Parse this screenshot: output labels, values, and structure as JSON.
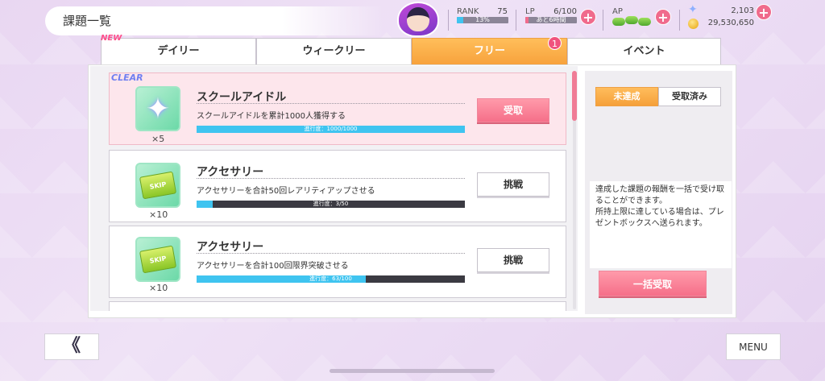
{
  "header": {
    "title": "課題一覧",
    "rank_label": "RANK",
    "rank_value": "75",
    "rank_progress_text": "13%",
    "rank_progress": 0.13,
    "lp_label": "LP",
    "lp_value": "6/100",
    "lp_timer": "あと6時間",
    "lp_progress": 0.06,
    "ap_label": "AP",
    "gems": "2,103",
    "coins": "29,530,650",
    "plus": "+"
  },
  "tabs": [
    {
      "label": "デイリー",
      "tag": "NEW"
    },
    {
      "label": "ウィークリー"
    },
    {
      "label": "フリー",
      "active": true,
      "badge": "1"
    },
    {
      "label": "イベント"
    }
  ],
  "tasks": [
    {
      "status_tag": "CLEAR",
      "title": "スクールアイドル",
      "desc": "スクールアイドルを累計1000人獲得する",
      "progress_text": "進行度：1000/1000",
      "progress": 1.0,
      "qty": "×5",
      "icon": "star-crystal-icon",
      "button": "受取"
    },
    {
      "title": "アクセサリー",
      "desc": "アクセサリーを合計50回レアリティアップさせる",
      "progress_text": "進行度：3/50",
      "progress": 0.06,
      "qty": "×10",
      "icon": "skip-ticket-icon",
      "ticket_text": "SKIP",
      "button": "挑戦"
    },
    {
      "title": "アクセサリー",
      "desc": "アクセサリーを合計100回限界突破させる",
      "progress_text": "進行度：63/100",
      "progress": 0.63,
      "qty": "×10",
      "icon": "skip-ticket-icon",
      "ticket_text": "SKIP",
      "button": "挑戦"
    }
  ],
  "filter": {
    "incomplete": "未達成",
    "received": "受取済み"
  },
  "note": "達成した課題の報酬を一括で受け取ることができます。\n所持上限に達している場合は、プレゼントボックスへ送られます。",
  "bulk_button": "一括受取",
  "footer": {
    "back": "《",
    "menu": "MENU"
  },
  "colors": {
    "accent_orange": "#f7a23c",
    "accent_pink": "#f56f89",
    "progress_blue": "#3fc4f0"
  }
}
